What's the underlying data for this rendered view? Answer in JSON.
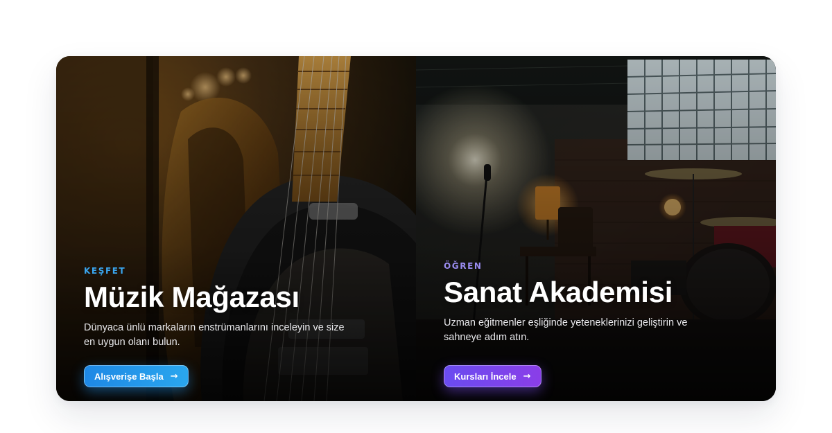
{
  "cards": [
    {
      "eyebrow": "KEŞFET",
      "title": "Müzik Mağazası",
      "description": "Dünyaca ünlü markaların enstrümanlarını inceleyin ve size en uygun olanı bulun.",
      "cta_label": "Alışverişe Başla",
      "cta_icon": "arrow-right-icon",
      "accent": "#2196f3",
      "image": "electric-guitar-photo"
    },
    {
      "eyebrow": "ÖĞREN",
      "title": "Sanat Akademisi",
      "description": "Uzman eğitmenler eşliğinde yeteneklerinizi geliştirin ve sahneye adım atın.",
      "cta_label": "Kursları İncele",
      "cta_icon": "arrow-right-icon",
      "accent": "#7c4dff",
      "image": "music-studio-photo"
    }
  ]
}
